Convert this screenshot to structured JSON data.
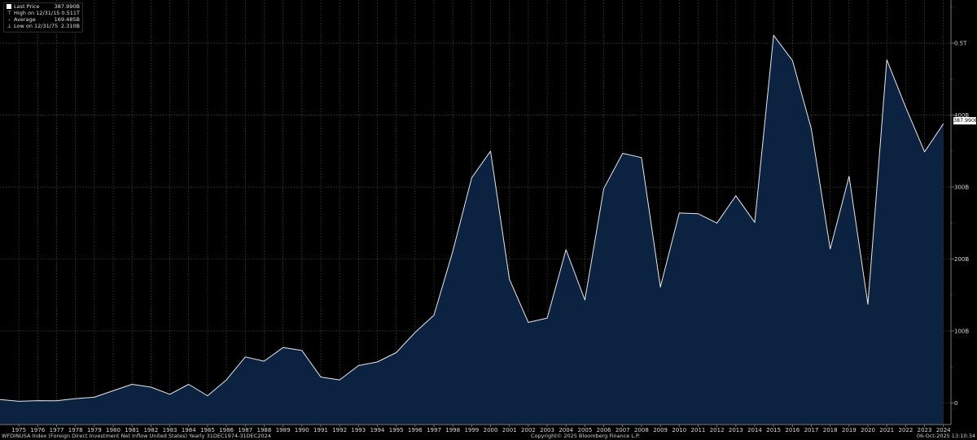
{
  "legend": {
    "last_price_label": "Last Price",
    "last_price_value": "387.990B",
    "high_label": "High on 12/31/15",
    "high_value": "0.511T",
    "average_label": "Average",
    "average_value": "169.485B",
    "low_label": "Low on 12/31/75",
    "low_value": "2.310B"
  },
  "last_value_tag": "387.990B",
  "footer": {
    "left": "WFDINUSA Index (Foreign Direct Investment Net Inflow United States) Yearly 31DEC1974-31DEC2024",
    "center": "Copyright© 2025 Bloomberg Finance L.P.",
    "right": "06-Oct-2025 13:10:34"
  },
  "colors": {
    "background": "#000000",
    "area_fill": "#0b2340",
    "line": "#e8e8e8",
    "grid": "#555555"
  },
  "chart_data": {
    "type": "area",
    "x": [
      1974,
      1975,
      1976,
      1977,
      1978,
      1979,
      1980,
      1981,
      1982,
      1983,
      1984,
      1985,
      1986,
      1987,
      1988,
      1989,
      1990,
      1991,
      1992,
      1993,
      1994,
      1995,
      1996,
      1997,
      1998,
      1999,
      2000,
      2001,
      2002,
      2003,
      2004,
      2005,
      2006,
      2007,
      2008,
      2009,
      2010,
      2011,
      2012,
      2013,
      2014,
      2015,
      2016,
      2017,
      2018,
      2019,
      2020,
      2021,
      2022,
      2023,
      2024
    ],
    "series": [
      {
        "values": [
          4.8,
          2.3,
          3.2,
          3.0,
          6.0,
          8.0,
          17.0,
          26.0,
          22.0,
          12.0,
          26.0,
          10.0,
          32.0,
          64.0,
          58.0,
          77.0,
          73.0,
          36.0,
          32.0,
          52.0,
          57.0,
          70.0,
          98.0,
          122.0,
          211.0,
          313.0,
          350.0,
          172.0,
          112.0,
          118.0,
          213.0,
          143.0,
          298.0,
          347.0,
          341.0,
          161.0,
          264.0,
          263.0,
          250.0,
          288.0,
          251.0,
          511.0,
          476.0,
          381.0,
          214.0,
          315.0,
          137.0,
          477.0,
          411.0,
          349.0,
          388.0
        ]
      }
    ],
    "x_tick_labels": [
      "1975",
      "1976",
      "1977",
      "1978",
      "1979",
      "1980",
      "1981",
      "1982",
      "1983",
      "1984",
      "1985",
      "1986",
      "1987",
      "1988",
      "1989",
      "1990",
      "1991",
      "1992",
      "1993",
      "1994",
      "1995",
      "1996",
      "1997",
      "1998",
      "1999",
      "2000",
      "2001",
      "2002",
      "2003",
      "2004",
      "2005",
      "2006",
      "2007",
      "2008",
      "2009",
      "2010",
      "2011",
      "2012",
      "2013",
      "2014",
      "2015",
      "2016",
      "2017",
      "2018",
      "2019",
      "2020",
      "2021",
      "2022",
      "2023",
      "2024"
    ],
    "y_ticks": [
      0,
      100,
      200,
      300,
      400,
      500
    ],
    "y_tick_labels": [
      "0",
      "100B",
      "200B",
      "300B",
      "400B",
      "0.5T"
    ],
    "y_unit": "B",
    "ylim": [
      -30,
      560
    ],
    "xlim": [
      1974,
      2024.4
    ],
    "grid": true,
    "y_axis_position": "right"
  }
}
